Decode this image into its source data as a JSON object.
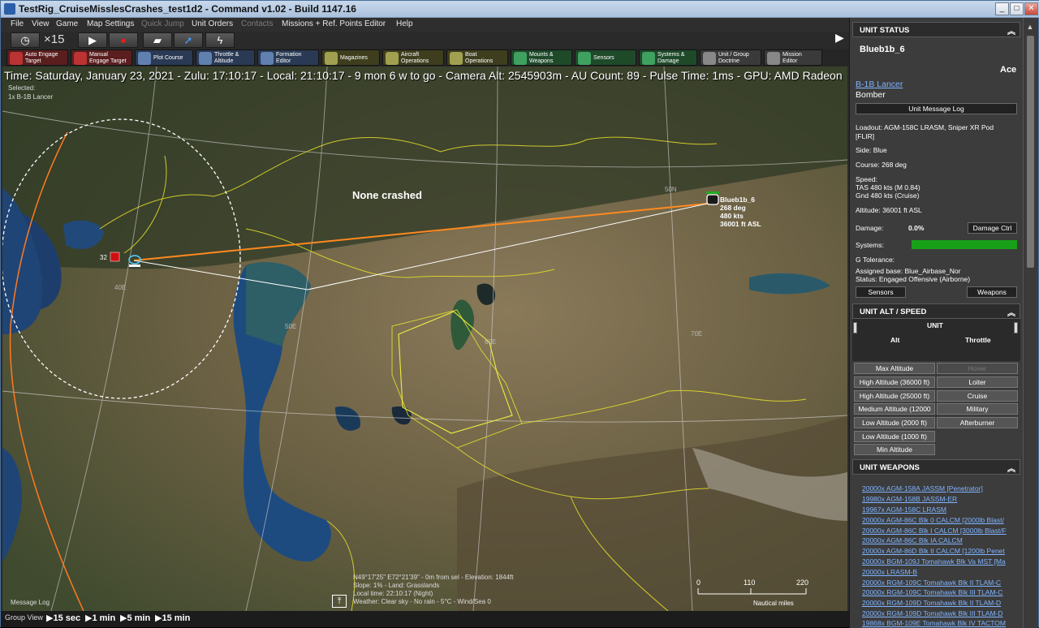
{
  "window": {
    "title": "TestRig_CruiseMisslesCrashes_test1d2 - Command v1.02 - Build 1147.16",
    "min_label": "_",
    "max_label": "□",
    "close_label": "✕"
  },
  "menu": [
    "File",
    "View",
    "Game",
    "Map Settings",
    "Quick Jump",
    "Unit Orders",
    "Contacts",
    "Missions + Ref. Points",
    "Editor",
    "Help"
  ],
  "toolbar1": {
    "clock_icon": "clock-icon",
    "time_compression": "×15",
    "play_icon": "play-icon",
    "record_icon": "record-icon",
    "expand_arrow": "▶"
  },
  "toolbar2": [
    {
      "label": "Auto Engage\nTarget",
      "color": "#8b2a2a"
    },
    {
      "label": "Manual\nEngage Target",
      "color": "#8b2a2a"
    },
    {
      "label": "Plot Course",
      "color": "#3a5a8a"
    },
    {
      "label": "Throttle &\nAltitude",
      "color": "#3a5a8a"
    },
    {
      "label": "Formation\nEditor",
      "color": "#3a5a8a"
    },
    {
      "label": "Magazines",
      "color": "#5a5a2a"
    },
    {
      "label": "Aircraft\nOperations",
      "color": "#5a5a2a"
    },
    {
      "label": "Boat\nOperations",
      "color": "#5a5a2a"
    },
    {
      "label": "Mounts &\nWeapons",
      "color": "#2a6a3a"
    },
    {
      "label": "Sensors",
      "color": "#2a6a3a"
    },
    {
      "label": "Systems &\nDamage",
      "color": "#2a6a3a"
    },
    {
      "label": "Unit / Group\nDoctrine",
      "color": "#4a4a4a"
    },
    {
      "label": "Mission\nEditor",
      "color": "#4a4a4a"
    }
  ],
  "map": {
    "infobar": "Time: Saturday, January 23, 2021 - Zulu: 17:10:17 - Local: 21:10:17 - 9 mon 6 w to go -  Camera Alt: 2545903m  - AU Count: 89 - Pulse Time: 1ms - GPU: AMD Radeon",
    "selected_label": "Selected:",
    "selected_unit": "1x B-1B Lancer",
    "annotation": "None crashed",
    "unit_callout": [
      "Blueb1b_6",
      "268 deg",
      "480 kts",
      "36001 ft ASL"
    ],
    "contact_count": "32",
    "grid_labels": [
      "50N",
      "40E",
      "50E",
      "60E",
      "70E"
    ],
    "cursor_info": [
      "N49°17'25\" E72°21'39\" - 0m from sel - Elevation: 1844ft",
      "Slope: 1% - Land: Grasslands",
      "Local time: 22:10:17 (Night)",
      "Weather: Clear sky - No rain - 5°C - Wind/Sea 0"
    ],
    "scale_ticks": [
      "0",
      "110",
      "220"
    ],
    "scale_unit": "Nautical miles",
    "message_log": "Message Log"
  },
  "bottombar": {
    "group_view": "Group View",
    "steps": [
      "15 sec",
      "1 min",
      "5 min",
      "15 min"
    ]
  },
  "unit_status": {
    "header": "UNIT STATUS",
    "name": "Blueb1b_6",
    "proficiency": "Ace",
    "type_link": "B-1B Lancer",
    "role": "Bomber",
    "message_log_btn": "Unit Message Log",
    "loadout": "Loadout: AGM-158C LRASM, Sniper XR Pod",
    "loadout2": "[FLIR]",
    "side": "Side: Blue",
    "course": "Course: 268 deg",
    "speed_label": "Speed:",
    "tas": "TAS 480 kts (M 0.84)",
    "gnd": "Gnd 480 kts (Cruise)",
    "altitude": "Altitude: 36001 ft ASL",
    "damage_label": "Damage:",
    "damage_value": "0.0%",
    "damage_btn": "Damage Ctrl",
    "systems_label": "Systems:",
    "systems_fraction": 1.0,
    "g_tolerance": "G Tolerance:",
    "assigned_base": "Assigned base: Blue_Airbase_Nor",
    "status": "Status: Engaged Offensive (Airborne)",
    "sensors_btn": "Sensors",
    "weapons_btn": "Weapons"
  },
  "alt_speed": {
    "header": "UNIT ALT / SPEED",
    "unit_label": "UNIT",
    "alt_col": "Alt",
    "throttle_col": "Throttle",
    "alt_buttons": [
      "Max Altitude",
      "High Altitude (36000 ft)",
      "High Altitude (25000 ft)",
      "Medium Altitude (12000",
      "Low Altitude (2000 ft)",
      "Low Altitude (1000 ft)",
      "Min Altitude"
    ],
    "throttle_buttons": [
      "Hover",
      "Loiter",
      "Cruise",
      "Military",
      "Afterburner"
    ]
  },
  "weapons": {
    "header": "UNIT WEAPONS",
    "items": [
      "20000x AGM-158A JASSM [Penetrator]",
      "19980x AGM-158B JASSM-ER",
      "19967x AGM-158C LRASM",
      "20000x AGM-86C Blk 0 CALCM [2000lb Blast/",
      "20000x AGM-86C Blk I CALCM [3000lb Blast/F",
      "20000x AGM-86C Blk IA CALCM",
      "20000x AGM-86D Blk II CALCM [1200lb Penet",
      "20000x BGM-109J Tomahawk Blk Va MST [Ma",
      "20000x LRASM-B",
      "20000x RGM-109C Tomahawk Blk II TLAM-C",
      "20000x RGM-109C Tomahawk Blk III TLAM-C",
      "20000x RGM-109D Tomahawk Blk II TLAM-D",
      "20000x RGM-109D Tomahawk Blk III TLAM-D",
      "19868x BGM-109E Tomahawk Blk IV TACTOM"
    ]
  }
}
